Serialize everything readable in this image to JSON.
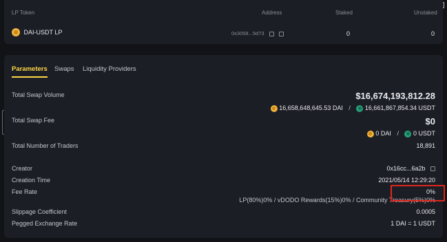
{
  "lp_table": {
    "headers": {
      "token": "LP Token",
      "address": "Address",
      "staked": "Staked",
      "unstaked": "Unstaked"
    },
    "row": {
      "token": "DAI-USDT LP",
      "address": "0x3058...5d73",
      "staked": "0",
      "unstaked": "0"
    }
  },
  "tabs": [
    {
      "label": "Parameters",
      "active": true
    },
    {
      "label": "Swaps",
      "active": false
    },
    {
      "label": "Liquidity Providers",
      "active": false
    }
  ],
  "params": {
    "total_swap_volume": {
      "label": "Total Swap Volume",
      "value": "$16,674,193,812.28",
      "dai": "16,658,648,645.53 DAI",
      "sep": "/",
      "usdt": "16,661,867,854.34 USDT"
    },
    "total_swap_fee": {
      "label": "Total Swap Fee",
      "value": "$0",
      "dai": "0 DAI",
      "sep": "/",
      "usdt": "0 USDT"
    },
    "traders": {
      "label": "Total Number of Traders",
      "value": "18,891"
    },
    "creator": {
      "label": "Creator",
      "value": "0x16cc...6a2b"
    },
    "creation_time": {
      "label": "Creation Time",
      "value": "2021/05/14 12:29:20"
    },
    "fee_rate": {
      "label": "Fee Rate",
      "value": "0%",
      "breakdown": "LP(80%)0% / vDODO Rewards(15%)0% / Community Treasury(5%)0%"
    },
    "slippage": {
      "label": "Slippage Coefficient",
      "value": "0.0005"
    },
    "pegged": {
      "label": "Pegged Exchange Rate",
      "value": "1 DAI = 1 USDT"
    }
  },
  "colors": {
    "background": "#121317",
    "panel": "#1c1e25",
    "accent": "#fed744",
    "highlight": "#e1261c",
    "dai": "#f2b33d",
    "usdt": "#26a17b"
  },
  "icons": [
    "dai-usdt-lp-icon",
    "external-link-icon",
    "copy-icon",
    "dai-icon",
    "usdt-icon",
    "chat-icon",
    "window-icon"
  ]
}
